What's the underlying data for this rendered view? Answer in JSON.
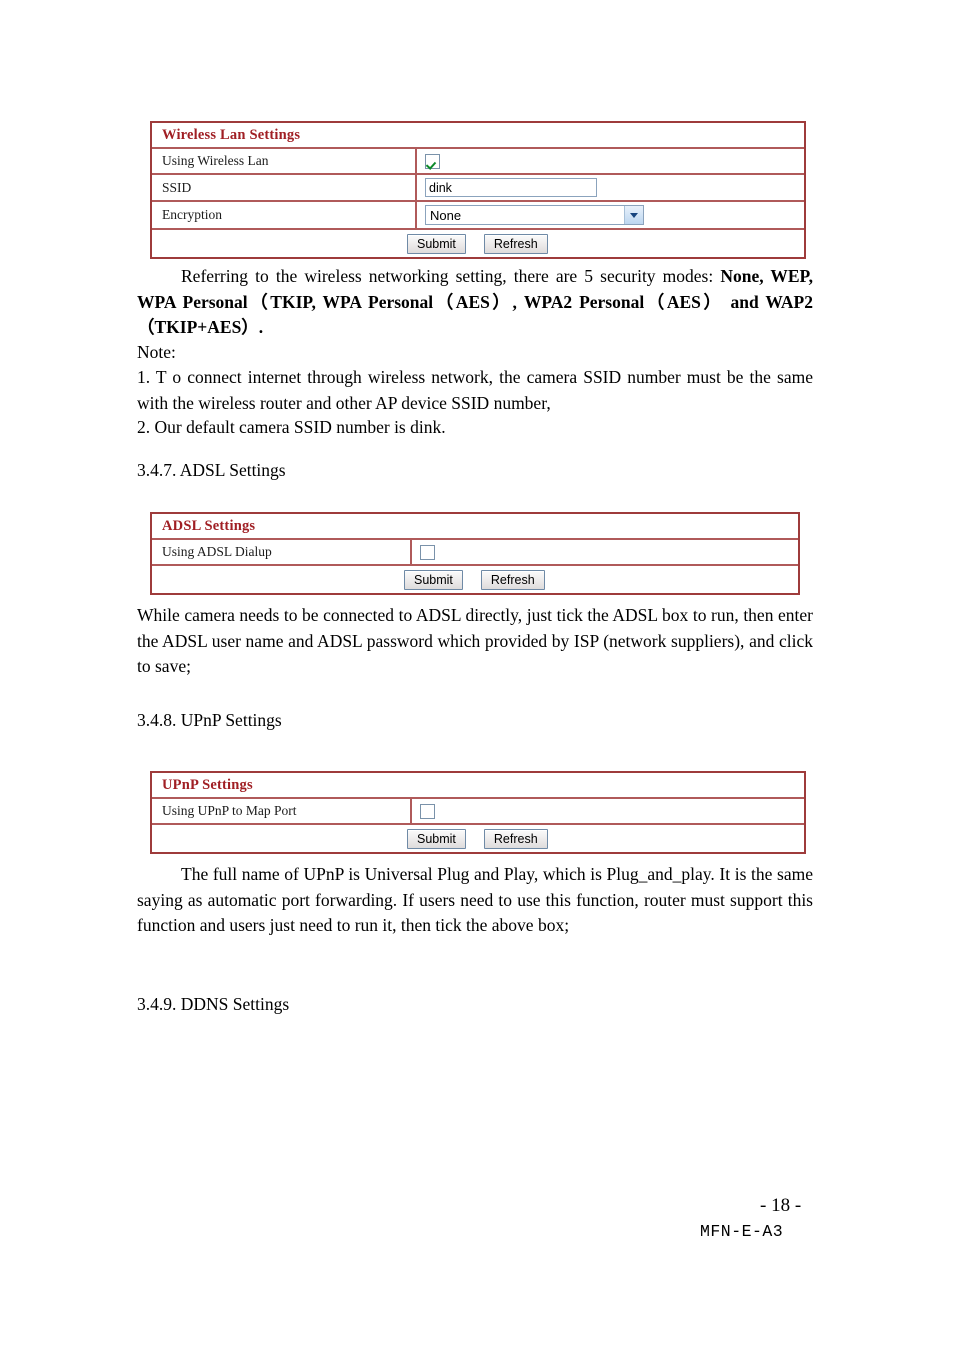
{
  "page": {
    "footer_page_number": "- 18 -",
    "footer_doc_code": "MFN-E-A3"
  },
  "colors": {
    "panel_border": "#9e3b3b",
    "panel_inner_border": "#b05a5a",
    "panel_title_text": "#a01f24",
    "checkbox_border": "#7a92aa",
    "check_mark": "#0c8a2a",
    "input_border": "#8ba3bd",
    "button_border": "#6f8aa6",
    "page_background": "#ffffff",
    "body_text": "#000000"
  },
  "wireless_panel": {
    "title": "Wireless Lan Settings",
    "rows": [
      {
        "label": "Using Wireless Lan",
        "control": "checkbox",
        "checked": true
      },
      {
        "label": "SSID",
        "control": "text",
        "value": "dink",
        "placeholder": ""
      },
      {
        "label": "Encryption",
        "control": "select",
        "selected": "None",
        "options": [
          "None",
          "WEP",
          "WPA Personal (TKIP)",
          "WPA Personal (AES)",
          "WPA2 Personal (AES)",
          "WAP2 (TKIP+AES)"
        ]
      }
    ],
    "submit_label": "Submit",
    "refresh_label": "Refresh"
  },
  "wireless_text": {
    "intro_plain": "Referring to the wireless networking setting, there are 5 security modes:",
    "intro_bold": "None, WEP, WPA Personal（TKIP, WPA Personal（AES）, WPA2 Personal（AES） and WAP2 （TKIP+AES）.",
    "note_label": "Note:",
    "note_1": "1. T o connect internet through wireless network, the camera SSID number must be the same with the wireless router and other AP device SSID number,",
    "note_2": "2. Our default camera SSID number is dink."
  },
  "adsl_section": {
    "heading": "3.4.7. ADSL Settings",
    "panel": {
      "title": "ADSL Settings",
      "rows": [
        {
          "label": "Using ADSL Dialup",
          "control": "checkbox",
          "checked": false
        }
      ],
      "submit_label": "Submit",
      "refresh_label": "Refresh"
    },
    "paragraph": "While camera needs to be connected to ADSL directly, just tick the ADSL box to run, then enter the ADSL user name and ADSL password which provided by ISP (network suppliers), and click to save;"
  },
  "upnp_section": {
    "heading": "3.4.8. UPnP Settings",
    "panel": {
      "title": "UPnP Settings",
      "rows": [
        {
          "label": "Using UPnP to Map Port",
          "control": "checkbox",
          "checked": false
        }
      ],
      "submit_label": "Submit",
      "refresh_label": "Refresh"
    },
    "paragraph": "The full name of UPnP is Universal Plug and Play, which is Plug_and_play. It is the same saying as automatic port forwarding. If users need to use this function, router must support this function and users just need to run it, then tick the above box;"
  },
  "ddns_section": {
    "heading": "3.4.9. DDNS Settings"
  }
}
